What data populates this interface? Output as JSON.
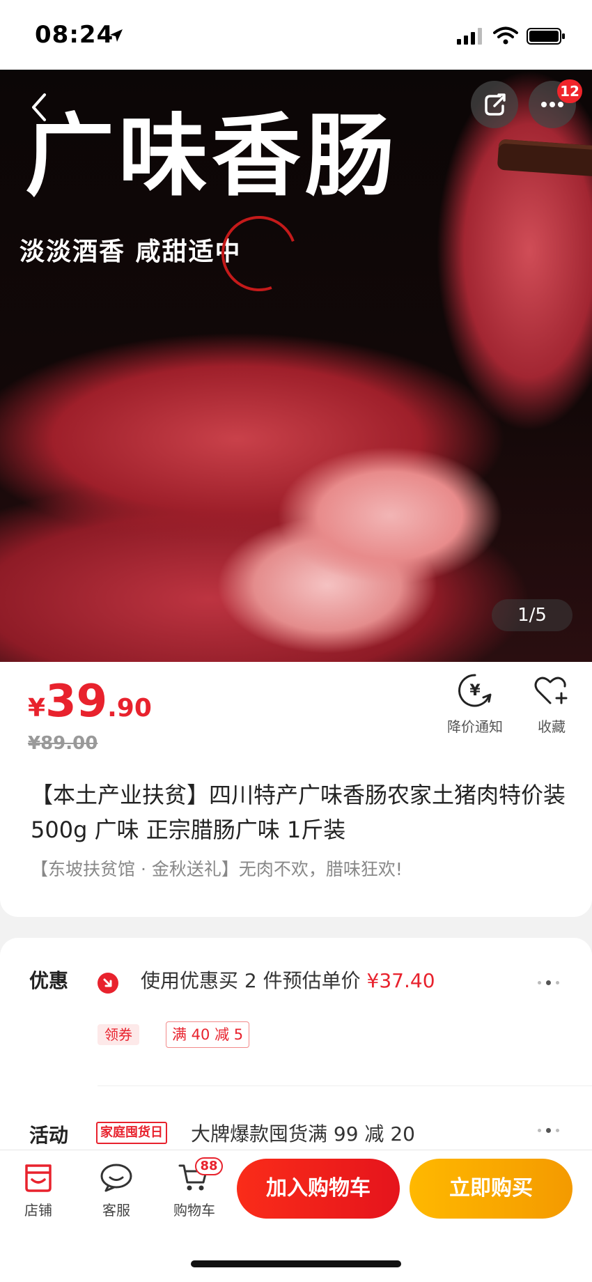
{
  "status_bar": {
    "time": "08:24"
  },
  "hero": {
    "title": "广味香肠",
    "subtitle": "淡淡酒香 咸甜适中",
    "more_badge": "12",
    "page_indicator": "1/5"
  },
  "product": {
    "price_symbol": "¥",
    "price_int": "39",
    "price_dec": ".90",
    "original_price": "¥89.00",
    "notify_label": "降价通知",
    "favorite_label": "收藏",
    "title": "【本土产业扶贫】四川特产广味香肠农家土猪肉特价装500g 广味 正宗腊肠广味 1斤装",
    "subtitle": "【东坡扶贫馆 · 金秋送礼】无肉不欢，腊味狂欢!"
  },
  "promo": {
    "discount_label": "优惠",
    "discount_text": "使用优惠买 2 件预估单价 ",
    "discount_price": "¥37.40",
    "coupon_chip": "领券",
    "coupon_tag": "满 40 减 5",
    "activity_label": "活动",
    "activity_badge": "家庭囤货日",
    "activity_text": "大牌爆款囤货满 99 减 20"
  },
  "bottom_bar": {
    "store_label": "店铺",
    "service_label": "客服",
    "cart_label": "购物车",
    "cart_badge": "88",
    "add_to_cart": "加入购物车",
    "buy_now": "立即购买"
  },
  "colors": {
    "accent_red": "#e8222d",
    "buy_orange": "#f49a00"
  }
}
